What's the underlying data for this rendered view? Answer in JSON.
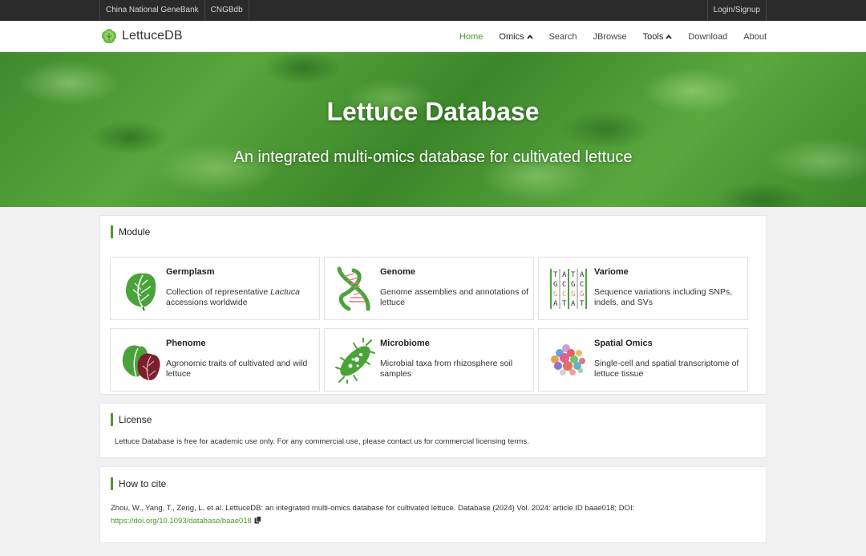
{
  "topbar": {
    "links": [
      "China National GeneBank",
      "CNGBdb"
    ],
    "login": "Login/Signup"
  },
  "navbar": {
    "brand": "LettuceDB",
    "items": [
      "Home",
      "Omics",
      "Search",
      "JBrowse",
      "Tools",
      "Download",
      "About"
    ]
  },
  "hero": {
    "title": "Lettuce Database",
    "subtitle": "An integrated multi-omics database for cultivated lettuce"
  },
  "module": {
    "title": "Module",
    "cards": [
      {
        "title": "Germplasm",
        "desc_pre": "Collection of representative ",
        "desc_em": "Lactuca",
        "desc_post": " accessions worldwide",
        "icon": "lettuce-leaf-icon"
      },
      {
        "title": "Genome",
        "desc": "Genome assemblies and annotations of lettuce",
        "icon": "dna-helix-icon"
      },
      {
        "title": "Variome",
        "desc": "Sequence variations including SNPs, indels, and SVs",
        "icon": "sequence-alignment-icon"
      },
      {
        "title": "Phenome",
        "desc": "Agronomic traits of cultivated and wild lettuce",
        "icon": "green-red-lettuce-icon"
      },
      {
        "title": "Microbiome",
        "desc": "Microbial taxa from rhizosphere soil samples",
        "icon": "microbe-icon"
      },
      {
        "title": "Spatial Omics",
        "desc": "Single-cell and spatial transcriptome of lettuce tissue",
        "icon": "spatial-cells-icon"
      }
    ],
    "variome_letters": [
      [
        "T",
        "A",
        "T",
        "A"
      ],
      [
        "G",
        "C",
        "G",
        "C"
      ],
      [
        "G",
        "C",
        "G",
        "G"
      ],
      [
        "A",
        "T",
        "A",
        "T"
      ]
    ]
  },
  "license": {
    "title": "License",
    "text": "Lettuce Database is free for academic use only. For any commercial use, please contact us for commercial licensing terms."
  },
  "cite": {
    "title": "How to cite",
    "text": "Zhou, W., Yang, T., Zeng, L. et al. LettuceDB: an integrated multi-omics database for cultivated lettuce. Database (2024) Vol. 2024: article ID baae018; DOI: ",
    "doi": "https://doi.org/10.1093/database/baae018"
  },
  "colors": {
    "accent": "#4a9a2c",
    "topbar": "#2b2b2b"
  }
}
